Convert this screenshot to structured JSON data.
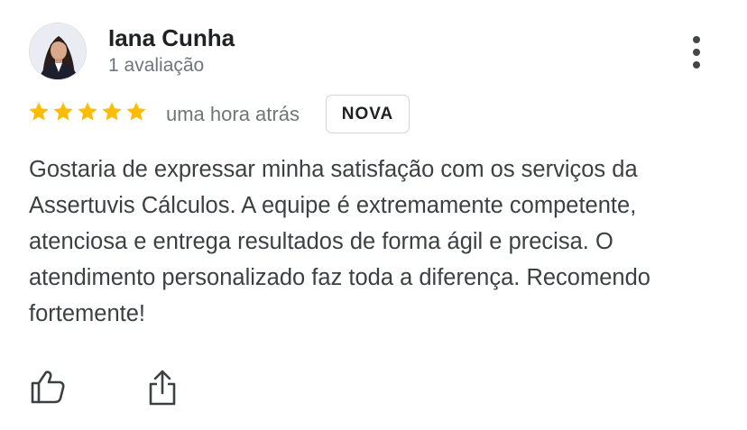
{
  "review": {
    "author": {
      "name": "Iana Cunha",
      "review_count": "1 avaliação"
    },
    "rating": 5,
    "timestamp": "uma hora atrás",
    "badge": "NOVA",
    "text": "Gostaria de expressar minha satisfação com os serviços da Assertuvis Cálculos. A equipe é extremamente competente, atenciosa e entrega resultados de forma ágil e precisa. O atendimento personalizado faz toda a diferença. Recomendo fortemente!"
  },
  "icons": {
    "avatar": "user-photo",
    "menu": "more-vertical-icon",
    "star": "star-icon",
    "like": "thumbs-up-icon",
    "share": "share-icon"
  },
  "colors": {
    "star": "#fbbc04",
    "text_primary": "#202124",
    "text_secondary": "#70757a",
    "badge_border": "#d2d5d9"
  }
}
